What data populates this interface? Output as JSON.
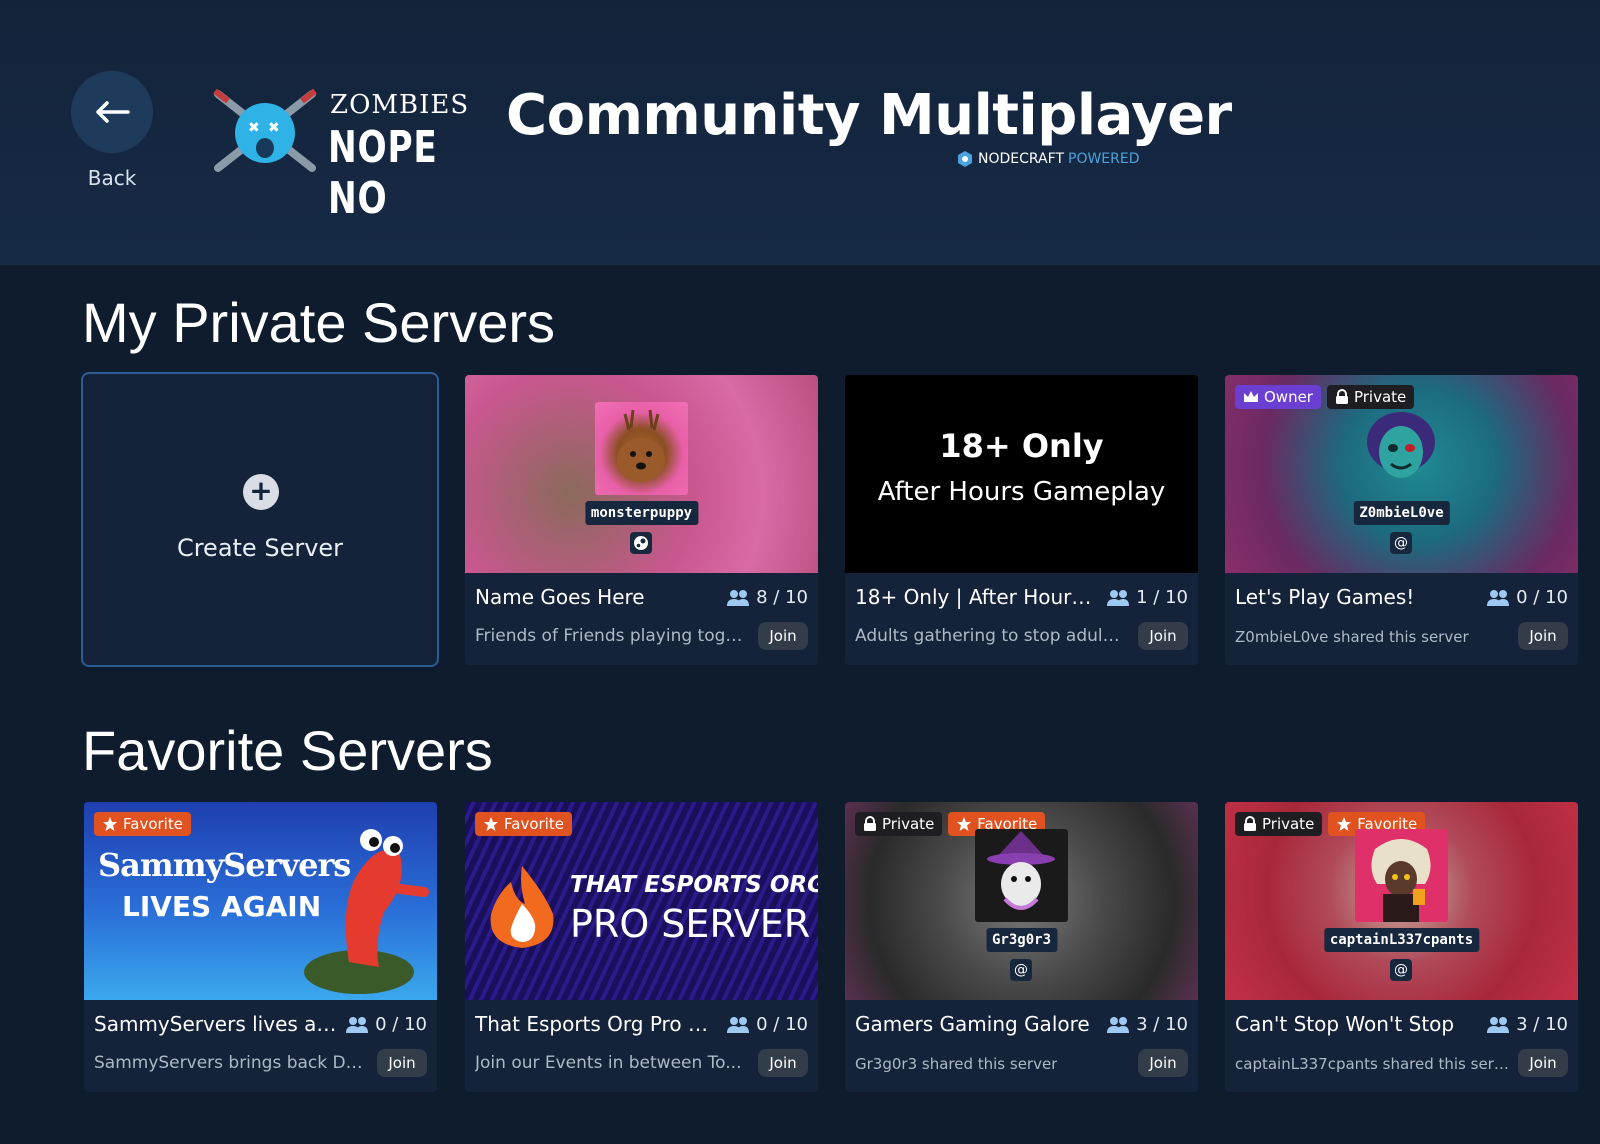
{
  "header": {
    "back_label": "Back",
    "logo_top": "ZOMBIES",
    "logo_bottom": "NOPE NO",
    "title": "Community Multiplayer",
    "powered_brand": "NODECRAFT",
    "powered_word": "POWERED"
  },
  "private_section": {
    "title": "My Private Servers",
    "create_label": "Create Server",
    "cards": [
      {
        "name": "Name Goes Here",
        "players": "8 / 10",
        "desc": "Friends of Friends playing toge...",
        "join": "Join",
        "avatar_name": "monsterpuppy",
        "platform_icon": "steam-icon"
      },
      {
        "name": "18+ Only | After Hours ...",
        "players": "1 / 10",
        "desc": "Adults gathering to stop adulti...",
        "join": "Join",
        "banner_title": "18+ Only",
        "banner_sub": "After Hours Gameplay"
      },
      {
        "name": "Let's Play Games!",
        "players": "0 / 10",
        "desc": "Z0mbieL0ve shared this server",
        "join": "Join",
        "avatar_name": "Z0mbieL0ve",
        "badge_owner": "Owner",
        "badge_private": "Private",
        "platform_icon": "at-icon"
      }
    ]
  },
  "favorite_section": {
    "title": "Favorite Servers",
    "cards": [
      {
        "name": "SammyServers lives again",
        "players": "0 / 10",
        "desc": "SammyServers brings back Di...",
        "join": "Join",
        "badge_favorite": "Favorite",
        "banner_line1": "SammyServers",
        "banner_line2": "LIVES AGAIN"
      },
      {
        "name": "That Esports Org Pro Se...",
        "players": "0 / 10",
        "desc": "Join our Events in between To...",
        "join": "Join",
        "badge_favorite": "Favorite",
        "banner_line1": "THAT ESPORTS ORG",
        "banner_line2": "PRO SERVER"
      },
      {
        "name": "Gamers Gaming Galore",
        "players": "3 / 10",
        "desc": "Gr3g0r3 shared this server",
        "join": "Join",
        "badge_private": "Private",
        "badge_favorite": "Favorite",
        "avatar_name": "Gr3g0r3",
        "platform_icon": "at-icon"
      },
      {
        "name": "Can't Stop Won't Stop",
        "players": "3 / 10",
        "desc": "captainL337cpants shared this server",
        "join": "Join",
        "badge_private": "Private",
        "badge_favorite": "Favorite",
        "avatar_name": "captainL337cpants",
        "platform_icon": "at-icon"
      }
    ]
  },
  "colors": {
    "background": "#0f1c2e",
    "card": "#15233a",
    "favorite_badge": "#e0521f",
    "owner_badge": "#6b3fd1",
    "private_badge": "#1e1e22",
    "accent_blue": "#4aa3df"
  }
}
